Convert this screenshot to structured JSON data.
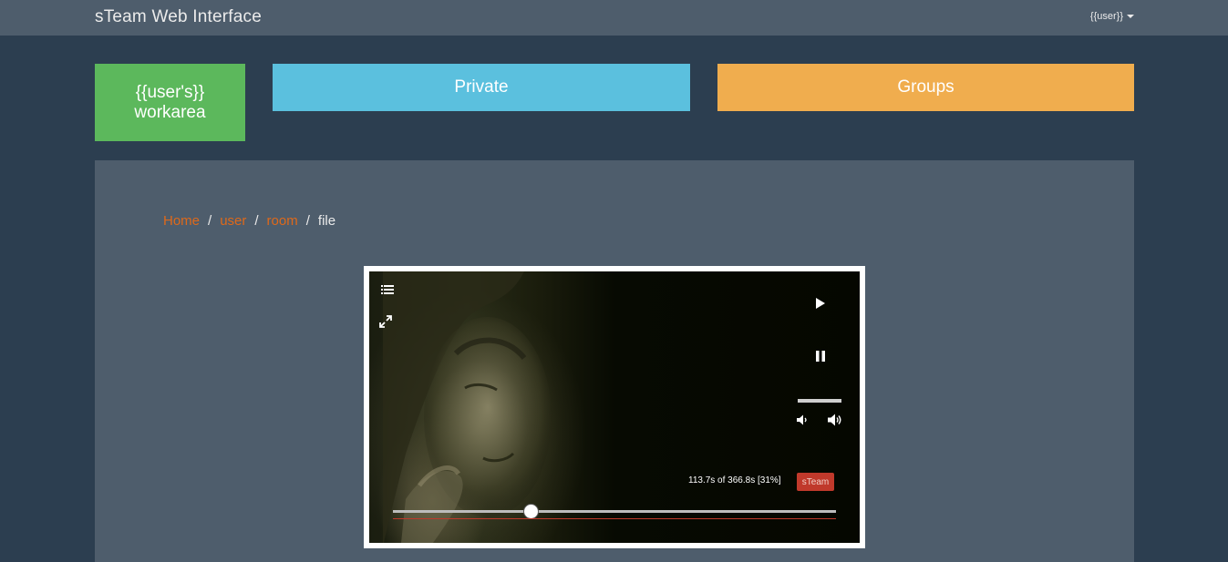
{
  "app": {
    "title": "sTeam Web Interface",
    "user_menu_label": "{{user}}"
  },
  "tiles": {
    "workarea_line1": "{{user's}}",
    "workarea_line2": "workarea",
    "private_label": "Private",
    "groups_label": "Groups"
  },
  "breadcrumb": {
    "home": "Home",
    "user": "user",
    "room": "room",
    "current": "file",
    "separator": "/"
  },
  "player": {
    "time_readout": "113.7s of 366.8s [31%]",
    "badge": "sTeam",
    "progress_fraction": 0.31,
    "icons": {
      "playlist": "playlist-icon",
      "fullscreen": "fullscreen-icon",
      "play": "play-icon",
      "pause": "pause-icon",
      "volume_down": "volume-down-icon",
      "volume_up": "volume-up-icon"
    }
  },
  "colors": {
    "background": "#2c3e50",
    "navbar": "#4e5d6c",
    "workarea_tile": "#5cb85c",
    "private_tile": "#5bc0de",
    "groups_tile": "#f0ad4e",
    "link": "#df691a",
    "badge": "#c0392b"
  }
}
